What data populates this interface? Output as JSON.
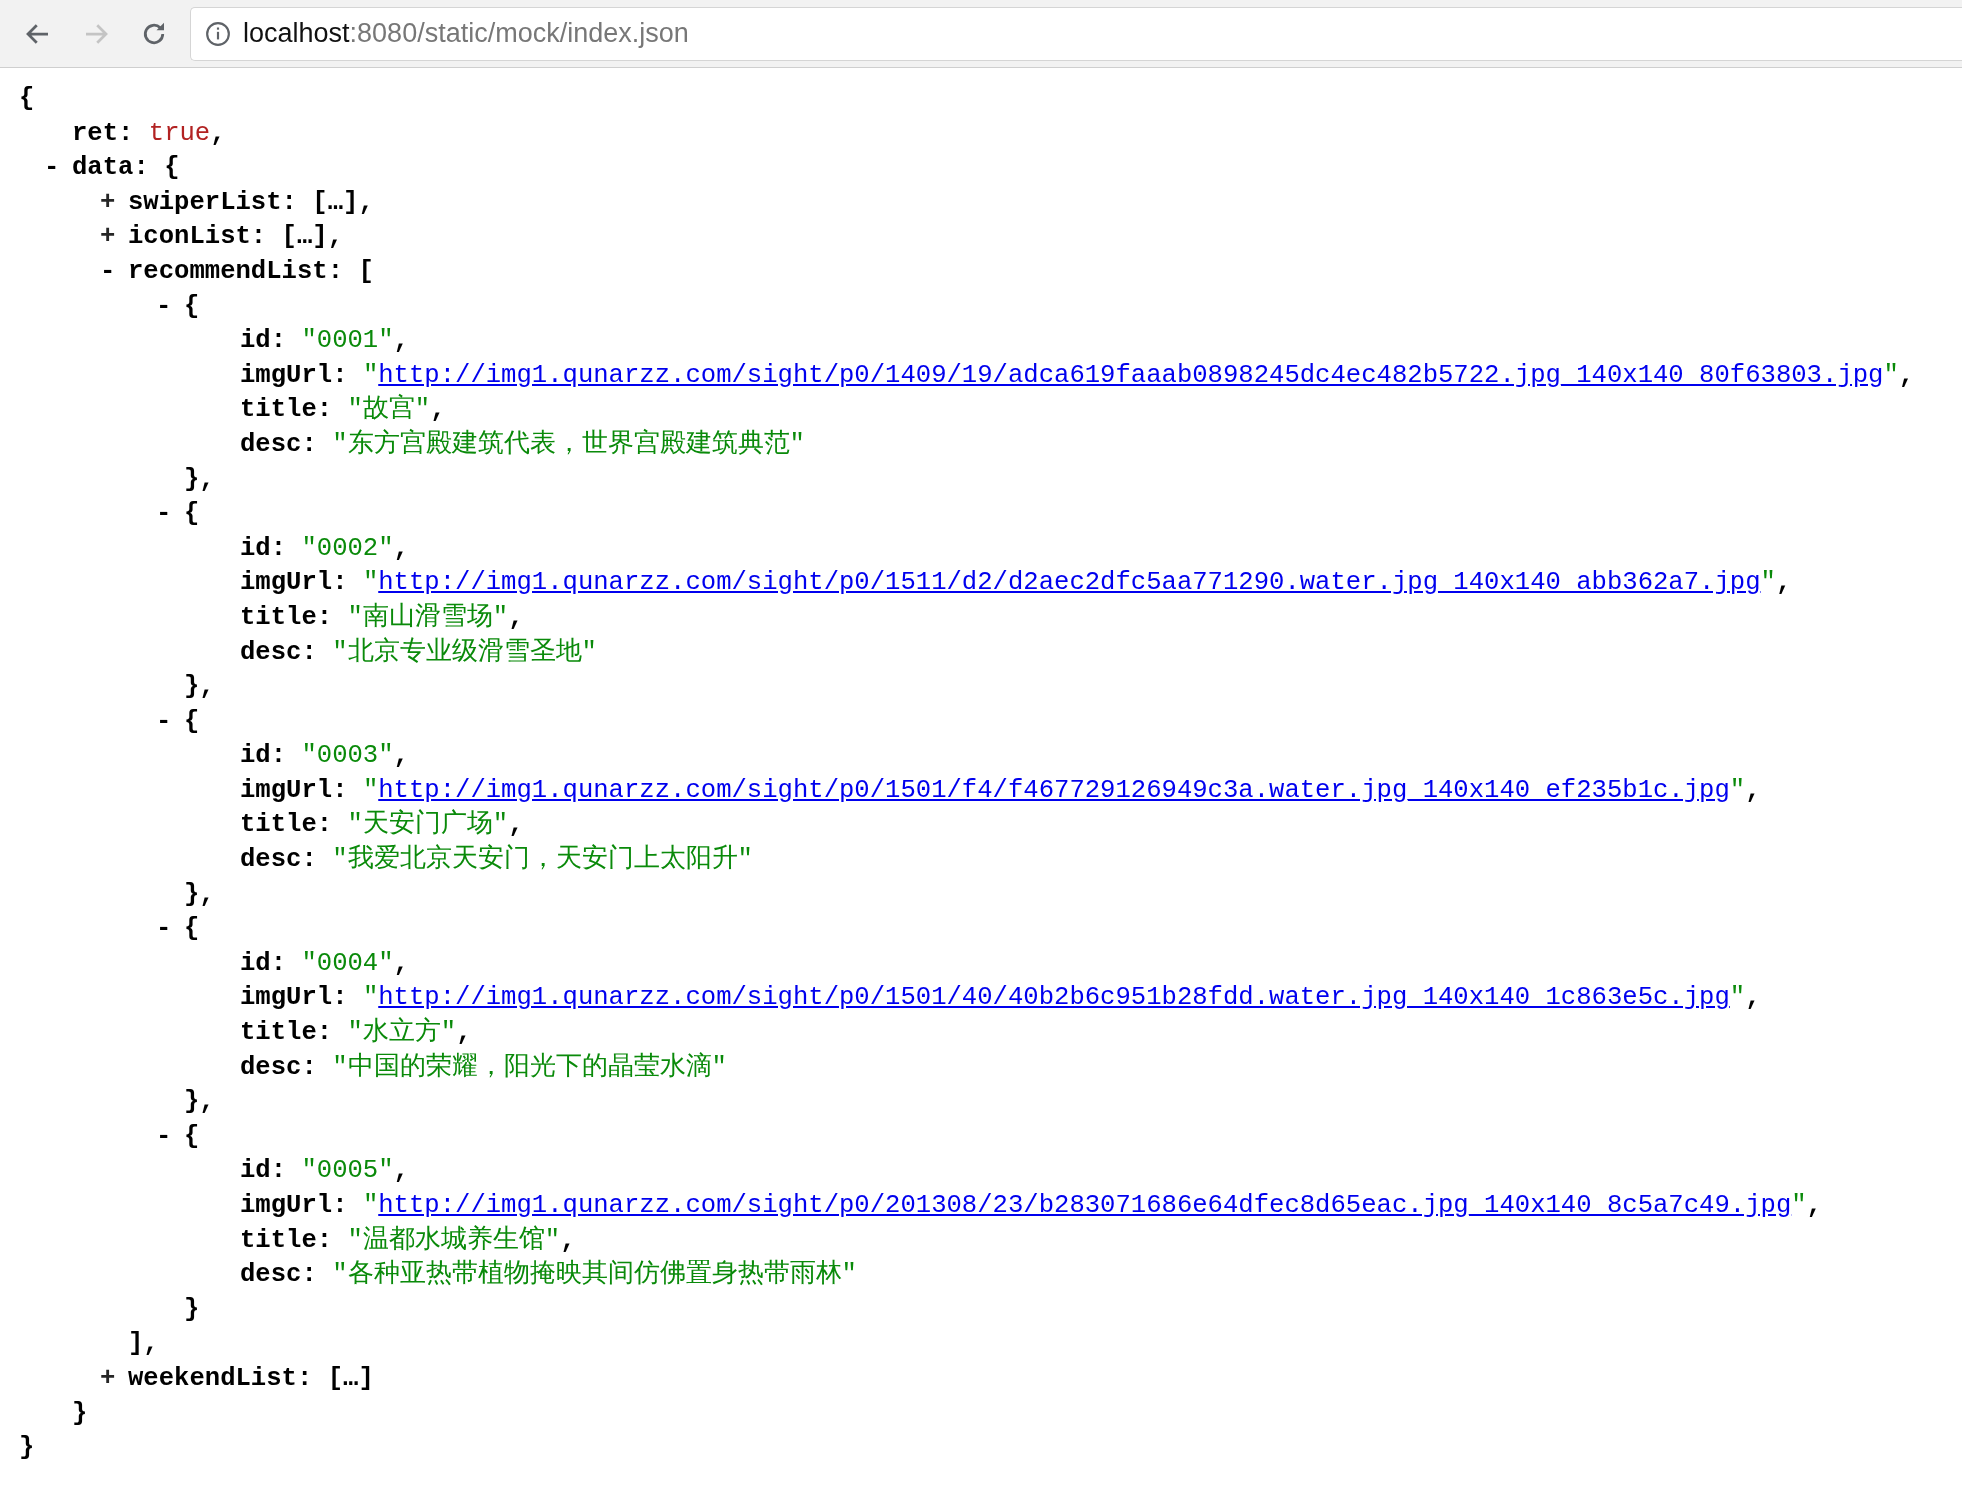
{
  "browser": {
    "back": {
      "disabled": false
    },
    "forward": {
      "disabled": true
    },
    "address": {
      "host": "localhost",
      "path": ":8080/static/mock/index.json"
    }
  },
  "document": {
    "open": "{",
    "close": "}",
    "children": [
      {
        "key": "ret:",
        "kind": "boolean",
        "value": "true",
        "comma": ","
      },
      {
        "toggle": "-",
        "expanded": true,
        "key": "data:",
        "open": "{",
        "close": "}",
        "children": [
          {
            "toggle": "+",
            "expanded": false,
            "key": "swiperList:",
            "open": "[",
            "ellipsis": "…",
            "close": "]",
            "comma": ","
          },
          {
            "toggle": "+",
            "expanded": false,
            "key": "iconList:",
            "open": "[",
            "ellipsis": "…",
            "close": "]",
            "comma": ","
          },
          {
            "toggle": "-",
            "expanded": true,
            "key": "recommendList:",
            "open": "[",
            "close": "]",
            "comma": ",",
            "children": [
              {
                "toggle": "-",
                "expanded": true,
                "open": "{",
                "close": "}",
                "comma": ",",
                "children": [
                  {
                    "key": "id:",
                    "kind": "string",
                    "quote": "\"",
                    "value": "0001",
                    "comma": ","
                  },
                  {
                    "key": "imgUrl:",
                    "kind": "link",
                    "quote": "\"",
                    "value": "http://img1.qunarzz.com/sight/p0/1409/19/adca619faaab0898245dc4ec482b5722.jpg_140x140_80f63803.jpg",
                    "comma": ","
                  },
                  {
                    "key": "title:",
                    "kind": "string",
                    "quote": "\"",
                    "value": "故宫",
                    "comma": ","
                  },
                  {
                    "key": "desc:",
                    "kind": "string",
                    "quote": "\"",
                    "value": "东方宫殿建筑代表，世界宫殿建筑典范"
                  }
                ]
              },
              {
                "toggle": "-",
                "expanded": true,
                "open": "{",
                "close": "}",
                "comma": ",",
                "children": [
                  {
                    "key": "id:",
                    "kind": "string",
                    "quote": "\"",
                    "value": "0002",
                    "comma": ","
                  },
                  {
                    "key": "imgUrl:",
                    "kind": "link",
                    "quote": "\"",
                    "value": "http://img1.qunarzz.com/sight/p0/1511/d2/d2aec2dfc5aa771290.water.jpg_140x140_abb362a7.jpg",
                    "comma": ","
                  },
                  {
                    "key": "title:",
                    "kind": "string",
                    "quote": "\"",
                    "value": "南山滑雪场",
                    "comma": ","
                  },
                  {
                    "key": "desc:",
                    "kind": "string",
                    "quote": "\"",
                    "value": "北京专业级滑雪圣地"
                  }
                ]
              },
              {
                "toggle": "-",
                "expanded": true,
                "open": "{",
                "close": "}",
                "comma": ",",
                "children": [
                  {
                    "key": "id:",
                    "kind": "string",
                    "quote": "\"",
                    "value": "0003",
                    "comma": ","
                  },
                  {
                    "key": "imgUrl:",
                    "kind": "link",
                    "quote": "\"",
                    "value": "http://img1.qunarzz.com/sight/p0/1501/f4/f467729126949c3a.water.jpg_140x140_ef235b1c.jpg",
                    "comma": ","
                  },
                  {
                    "key": "title:",
                    "kind": "string",
                    "quote": "\"",
                    "value": "天安门广场",
                    "comma": ","
                  },
                  {
                    "key": "desc:",
                    "kind": "string",
                    "quote": "\"",
                    "value": "我爱北京天安门，天安门上太阳升"
                  }
                ]
              },
              {
                "toggle": "-",
                "expanded": true,
                "open": "{",
                "close": "}",
                "comma": ",",
                "children": [
                  {
                    "key": "id:",
                    "kind": "string",
                    "quote": "\"",
                    "value": "0004",
                    "comma": ","
                  },
                  {
                    "key": "imgUrl:",
                    "kind": "link",
                    "quote": "\"",
                    "value": "http://img1.qunarzz.com/sight/p0/1501/40/40b2b6c951b28fdd.water.jpg_140x140_1c863e5c.jpg",
                    "comma": ","
                  },
                  {
                    "key": "title:",
                    "kind": "string",
                    "quote": "\"",
                    "value": "水立方",
                    "comma": ","
                  },
                  {
                    "key": "desc:",
                    "kind": "string",
                    "quote": "\"",
                    "value": "中国的荣耀，阳光下的晶莹水滴"
                  }
                ]
              },
              {
                "toggle": "-",
                "expanded": true,
                "open": "{",
                "close": "}",
                "children": [
                  {
                    "key": "id:",
                    "kind": "string",
                    "quote": "\"",
                    "value": "0005",
                    "comma": ","
                  },
                  {
                    "key": "imgUrl:",
                    "kind": "link",
                    "quote": "\"",
                    "value": "http://img1.qunarzz.com/sight/p0/201308/23/b283071686e64dfec8d65eac.jpg_140x140_8c5a7c49.jpg",
                    "comma": ","
                  },
                  {
                    "key": "title:",
                    "kind": "string",
                    "quote": "\"",
                    "value": "温都水城养生馆",
                    "comma": ","
                  },
                  {
                    "key": "desc:",
                    "kind": "string",
                    "quote": "\"",
                    "value": "各种亚热带植物掩映其间仿佛置身热带雨林"
                  }
                ]
              }
            ]
          },
          {
            "toggle": "+",
            "expanded": false,
            "key": "weekendList:",
            "open": "[",
            "ellipsis": "…",
            "close": "]"
          }
        ]
      }
    ]
  }
}
